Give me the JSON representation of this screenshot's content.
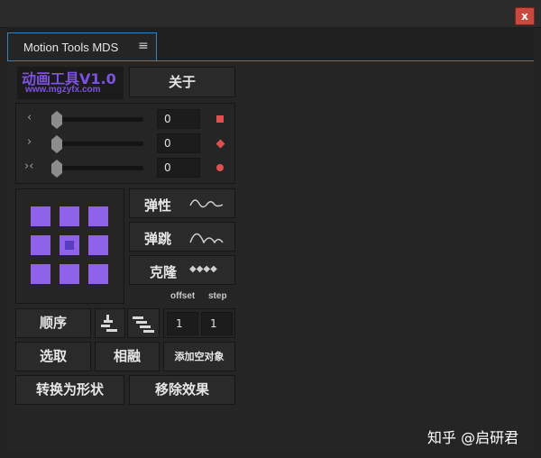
{
  "window": {
    "close_symbol": "x"
  },
  "tab": {
    "label": "Motion Tools MDS",
    "menu_symbol": "≡"
  },
  "logo": {
    "title": "动画工具V1.0",
    "url": "www.mgzyfx.com"
  },
  "buttons": {
    "about": "关于",
    "elastic": "弹性",
    "bounce": "弹跳",
    "clone": "克隆",
    "order": "顺序",
    "select": "选取",
    "blend": "相融",
    "add_null": "添加空对象",
    "convert_shape": "转换为形状",
    "remove_effects": "移除效果"
  },
  "sliders": [
    {
      "icon": "‹",
      "value": "0",
      "marker": "square"
    },
    {
      "icon": "›",
      "value": "0",
      "marker": "diamond"
    },
    {
      "icon": "›‹",
      "value": "0",
      "marker": "circle"
    }
  ],
  "clone_controls": {
    "offset_label": "offset",
    "step_label": "step",
    "offset_value": "1",
    "step_value": "1"
  },
  "colors": {
    "accent": "#8f63e8",
    "marker": "#e05050",
    "tab_border": "#3c80b8"
  },
  "watermark": "知乎 @启研君"
}
